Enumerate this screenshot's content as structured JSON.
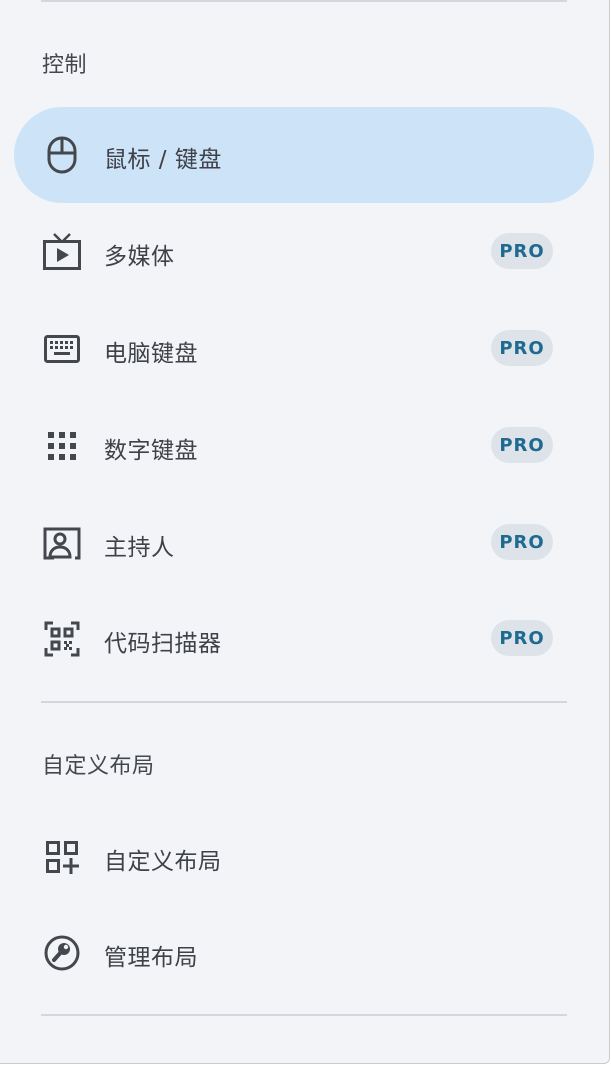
{
  "sections": [
    {
      "title": "控制",
      "items": [
        {
          "label": "鼠标 / 键盘",
          "icon": "mouse-icon",
          "active": true,
          "badge": ""
        },
        {
          "label": "多媒体",
          "icon": "tv-play-icon",
          "active": false,
          "badge": "PRO"
        },
        {
          "label": "电脑键盘",
          "icon": "keyboard-icon",
          "active": false,
          "badge": "PRO"
        },
        {
          "label": "数字键盘",
          "icon": "numpad-icon",
          "active": false,
          "badge": "PRO"
        },
        {
          "label": "主持人",
          "icon": "presenter-icon",
          "active": false,
          "badge": "PRO"
        },
        {
          "label": "代码扫描器",
          "icon": "qr-scanner-icon",
          "active": false,
          "badge": "PRO"
        }
      ]
    },
    {
      "title": "自定义布局",
      "items": [
        {
          "label": "自定义布局",
          "icon": "widgets-add-icon",
          "active": false,
          "badge": ""
        },
        {
          "label": "管理布局",
          "icon": "wrench-icon",
          "active": false,
          "badge": ""
        }
      ]
    }
  ],
  "colors": {
    "background": "#f2f4f8",
    "active_background": "#cde3f8",
    "pro_badge_background": "#dee3ea",
    "pro_badge_text": "#1e6a90",
    "icon": "#44474e"
  }
}
